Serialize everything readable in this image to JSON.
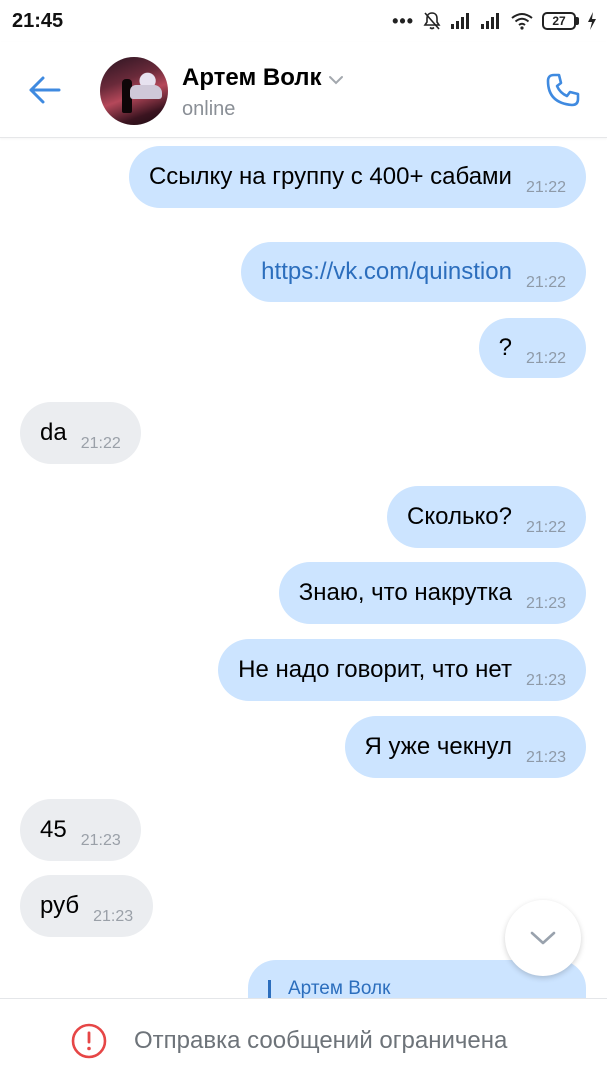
{
  "status_bar": {
    "time": "21:45",
    "dots": "•••",
    "battery": "27",
    "icons": [
      "bell-muted-icon",
      "signal-icon",
      "signal-icon",
      "wifi-icon",
      "battery-icon",
      "charging-icon"
    ]
  },
  "header": {
    "contact_name": "Артем Волк",
    "status": "online",
    "icons": [
      "back-arrow-icon",
      "chevron-down-icon",
      "phone-icon"
    ]
  },
  "messages": [
    {
      "dir": "out",
      "text": "Ссылку на группу с 400+ сабами",
      "time": "21:22"
    },
    {
      "dir": "out",
      "text": "https://vk.com/quinstion",
      "time": "21:22",
      "link": true
    },
    {
      "dir": "out",
      "text": "?",
      "time": "21:22"
    },
    {
      "dir": "in",
      "text": "da",
      "time": "21:22"
    },
    {
      "dir": "out",
      "text": "Сколько?",
      "time": "21:22"
    },
    {
      "dir": "out",
      "text": "Знаю, что накрутка",
      "time": "21:23"
    },
    {
      "dir": "out",
      "text": "Не надо говорит, что нет",
      "time": "21:23"
    },
    {
      "dir": "out",
      "text": "Я уже чекнул",
      "time": "21:23"
    },
    {
      "dir": "in",
      "text": "45",
      "time": "21:23"
    },
    {
      "dir": "in",
      "text": "руб",
      "time": "21:23"
    }
  ],
  "reply_preview": {
    "name": "Артем Волк"
  },
  "bottom_bar": {
    "text": "Отправка сообщений ограничена",
    "icon": "exclamation-circle-icon"
  },
  "colors": {
    "accent": "#2c6ebd",
    "outgoing_bubble": "#cce4ff",
    "incoming_bubble": "#ebedf0",
    "warning": "#e64646"
  }
}
